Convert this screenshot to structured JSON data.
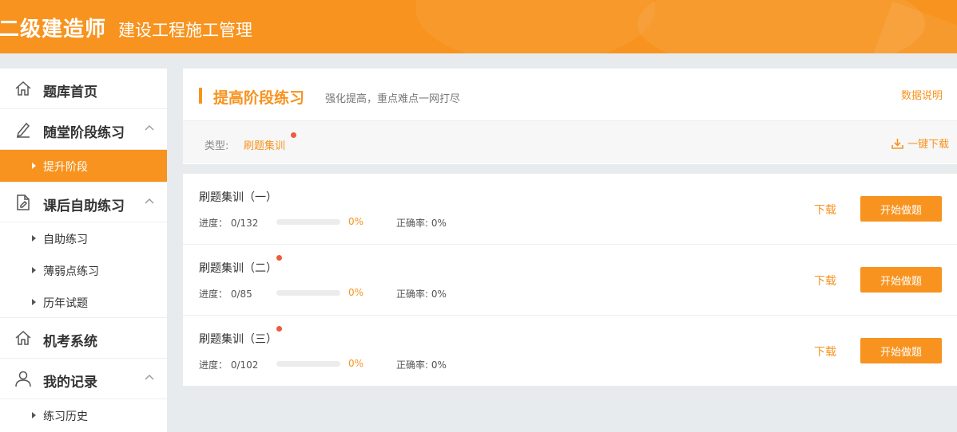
{
  "header": {
    "title": "二级建造师",
    "subtitle": "建设工程施工管理"
  },
  "sidebar": {
    "home": {
      "label": "题库首页",
      "icon": "home-icon"
    },
    "stage_practice": {
      "label": "随堂阶段练习",
      "icon": "pen-icon",
      "sub": [
        {
          "label": "提升阶段",
          "active": true
        }
      ]
    },
    "after_class": {
      "label": "课后自助练习",
      "icon": "document-edit-icon",
      "sub": [
        {
          "label": "自助练习"
        },
        {
          "label": "薄弱点练习"
        },
        {
          "label": "历年试题"
        }
      ]
    },
    "exam_system": {
      "label": "机考系统",
      "icon": "home-icon"
    },
    "my_records": {
      "label": "我的记录",
      "icon": "user-icon",
      "sub": [
        {
          "label": "练习历史"
        }
      ]
    }
  },
  "panel": {
    "title": "提高阶段练习",
    "description": "强化提高，重点难点一网打尽",
    "help_link": "数据说明",
    "type_label": "类型:",
    "type_value": "刷题集训",
    "download_all": "一键下载"
  },
  "items": [
    {
      "name": "刷题集训（一）",
      "new_dot": false,
      "progress_label": "进度： 0/132",
      "progress_fraction": 0,
      "percent": "0%",
      "accuracy": "正确率: 0%",
      "download": "下载",
      "start": "开始做题"
    },
    {
      "name": "刷题集训（二）",
      "new_dot": true,
      "progress_label": "进度： 0/85",
      "progress_fraction": 0,
      "percent": "0%",
      "accuracy": "正确率: 0%",
      "download": "下载",
      "start": "开始做题"
    },
    {
      "name": "刷题集训（三）",
      "new_dot": true,
      "progress_label": "进度： 0/102",
      "progress_fraction": 0,
      "percent": "0%",
      "accuracy": "正确率: 0%",
      "download": "下载",
      "start": "开始做题"
    }
  ],
  "colors": {
    "accent": "#f7931e",
    "dot": "#ee5a3c",
    "background": "#e8ebed"
  }
}
